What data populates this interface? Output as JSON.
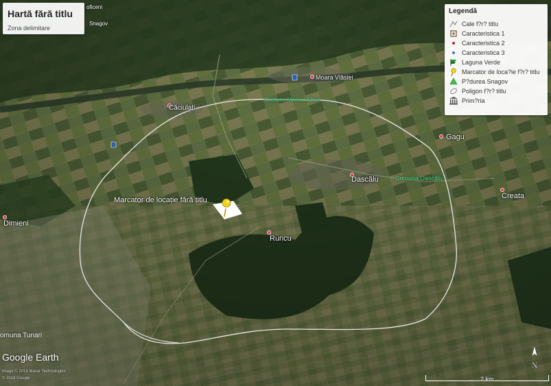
{
  "title": {
    "main": "Hartă fără titlu",
    "subtitle": "Zona delimitare"
  },
  "legend": {
    "title": "Legendă",
    "items": [
      {
        "label": "Cale f?r? titlu",
        "icon": "path-icon"
      },
      {
        "label": "Caracteristica 1",
        "icon": "square-feature-icon"
      },
      {
        "label": "Caracteristica 2",
        "icon": "red-dot-icon"
      },
      {
        "label": "Caracteristica 3",
        "icon": "blue-dot-icon"
      },
      {
        "label": "Laguna Verde",
        "icon": "flag-icon"
      },
      {
        "label": "Marcator de loca?ie f?r? titlu",
        "icon": "pushpin-icon"
      },
      {
        "label": "P?durea Snagov",
        "icon": "tree-icon"
      },
      {
        "label": "Poligon f?r? titlu",
        "icon": "polygon-icon"
      },
      {
        "label": "Prim?ria",
        "icon": "building-icon"
      }
    ]
  },
  "places": {
    "caciulati": "Căciulați",
    "moara_vlasiei": "Moara Vlăsiei",
    "comuna_moara_vlasiei": "Comuna Moara Vlăsiei",
    "gagu": "Gagu",
    "dascalu": "Dascălu",
    "comuna_dascalu": "Comuna Dascălu",
    "creata": "Creata",
    "dimieni": "Dimieni",
    "runcu": "Runcu",
    "comuna_tunari": "omuna Tunari",
    "snagov": "Snagov",
    "top_left": "oficeni"
  },
  "marker": {
    "label": "Marcator de locație fără titlu"
  },
  "footer": {
    "logo": "Google Earth",
    "credit1": "Image © 2019 Maxar Technologies",
    "credit2": "© 2018 Google",
    "scale": "2 km",
    "north": "N"
  },
  "colors": {
    "boundary": "#e8e8e8",
    "place_dot": "#e0405a",
    "marker": "#f2d21a",
    "area_label": "#4fe08a"
  }
}
